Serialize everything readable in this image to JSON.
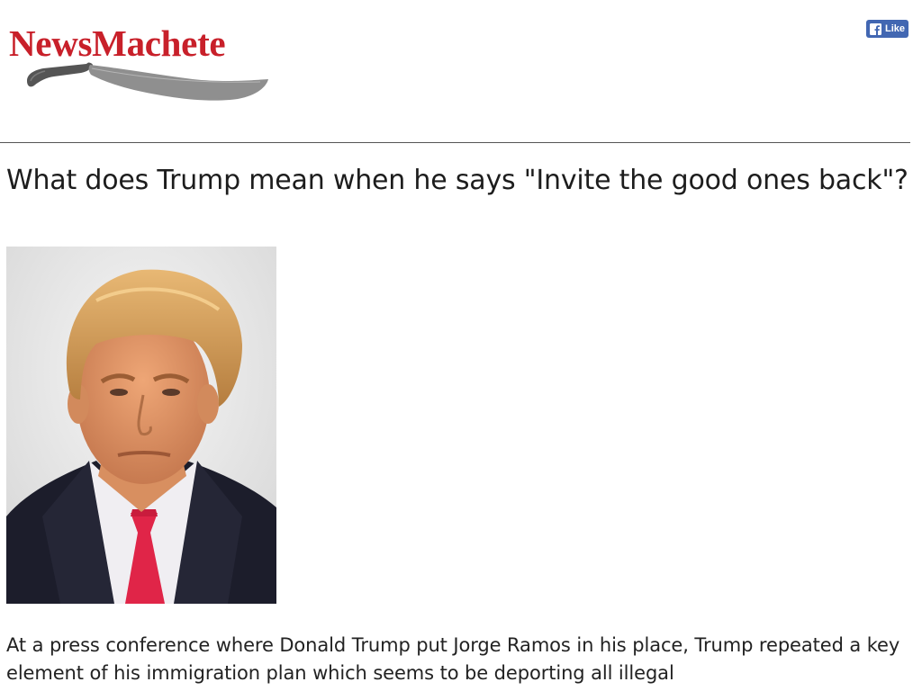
{
  "site": {
    "logo_text": "NewsMachete"
  },
  "facebook": {
    "like_label": "Like"
  },
  "article": {
    "title": "What does Trump mean when he says \"Invite the good ones back\"?",
    "body_paragraph": "At a press conference where Donald Trump put Jorge Ramos in his place, Trump repeated a key element of his immigration plan which seems to be deporting all illegal"
  },
  "colors": {
    "brand_red": "#c8202a",
    "facebook_blue": "#4267b2"
  },
  "icons": {
    "logo_graphic": "machete-icon",
    "facebook": "facebook-icon"
  }
}
